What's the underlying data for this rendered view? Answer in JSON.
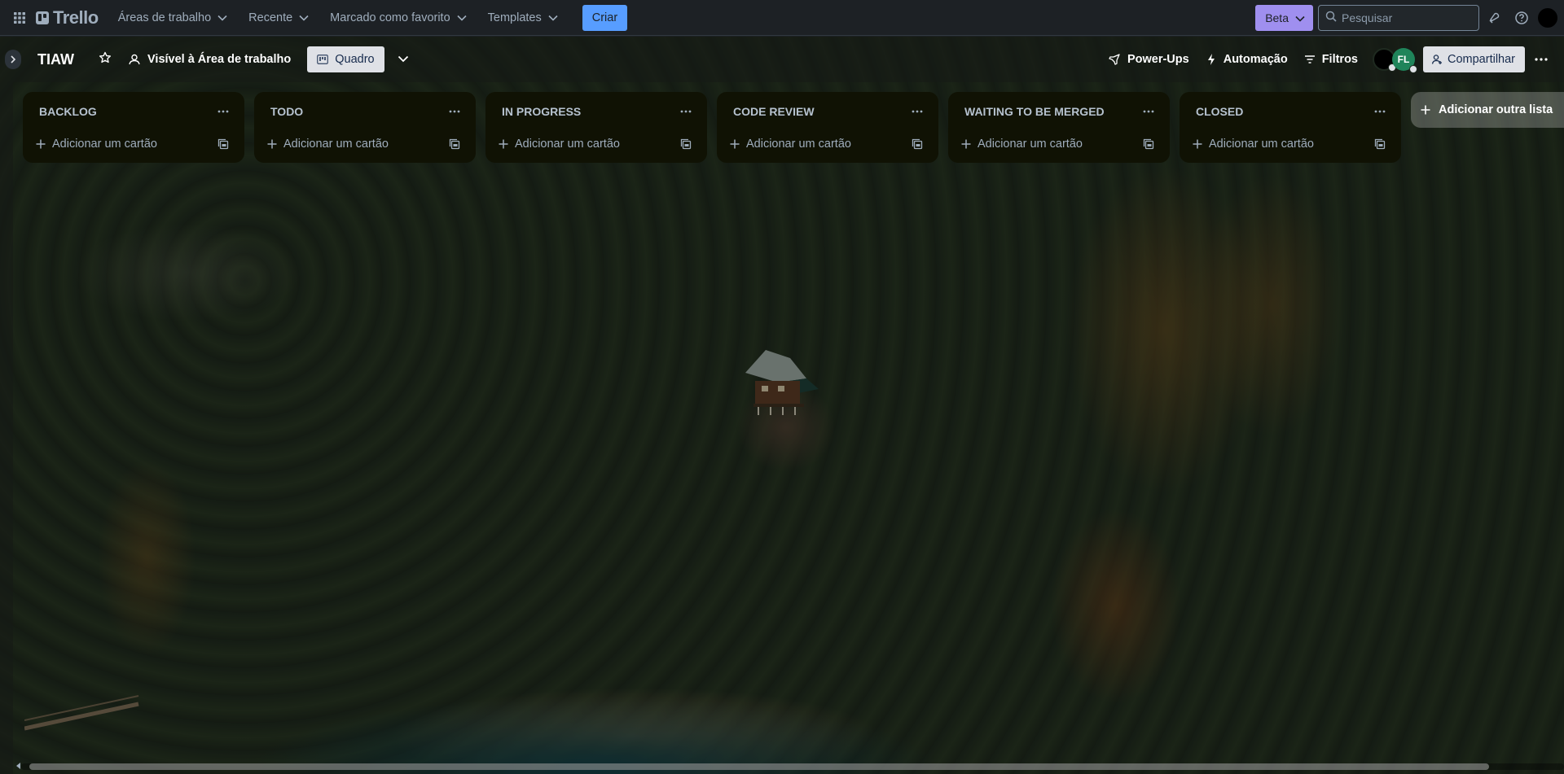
{
  "nav": {
    "logo_text": "Trello",
    "menus": [
      {
        "label": "Áreas de trabalho"
      },
      {
        "label": "Recente"
      },
      {
        "label": "Marcado como favorito"
      },
      {
        "label": "Templates"
      }
    ],
    "create_label": "Criar",
    "beta_label": "Beta",
    "search_placeholder": "Pesquisar"
  },
  "board": {
    "title": "TIAW",
    "visibility_label": "Visível à Área de trabalho",
    "view_label": "Quadro",
    "powerups_label": "Power-Ups",
    "automation_label": "Automação",
    "filters_label": "Filtros",
    "member_initials": "FL",
    "share_label": "Compartilhar",
    "add_list_label": "Adicionar outra lista"
  },
  "lists": [
    {
      "title": "BACKLOG",
      "add_card_label": "Adicionar um cartão"
    },
    {
      "title": "TODO",
      "add_card_label": "Adicionar um cartão"
    },
    {
      "title": "IN PROGRESS",
      "add_card_label": "Adicionar um cartão"
    },
    {
      "title": "CODE REVIEW",
      "add_card_label": "Adicionar um cartão"
    },
    {
      "title": "WAITING TO BE MERGED",
      "add_card_label": "Adicionar um cartão"
    },
    {
      "title": "CLOSED",
      "add_card_label": "Adicionar um cartão"
    }
  ],
  "colors": {
    "accent_create": "#579dff",
    "accent_beta": "#9f8fef",
    "avatar_member": "#1f845a",
    "list_bg": "#101204"
  },
  "icons": [
    "apps-grid-icon",
    "chevron-down-icon",
    "search-icon",
    "notification-icon",
    "help-icon",
    "sidebar-expand-icon",
    "star-icon",
    "visibility-icon",
    "board-view-icon",
    "rocket-icon",
    "lightning-icon",
    "filter-icon",
    "add-person-icon",
    "ellipsis-icon",
    "plus-icon",
    "card-template-icon"
  ]
}
